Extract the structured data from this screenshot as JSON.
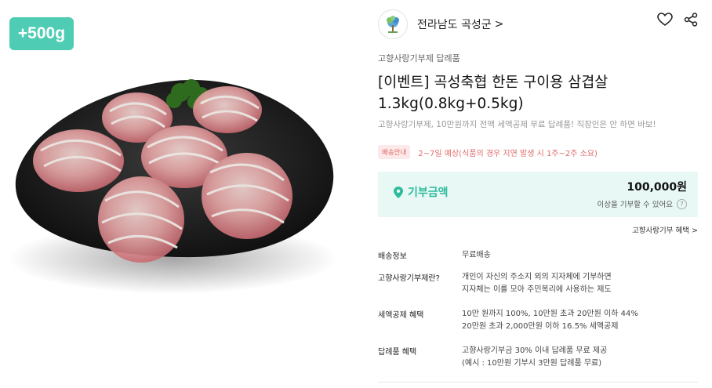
{
  "badge": "+500g",
  "seller": {
    "name": "전라남도 곡성군",
    "chevron": ">"
  },
  "icons": {
    "logo": "tree-logo-icon",
    "like": "heart-icon",
    "share": "share-icon"
  },
  "category": "고향사랑기부제 답례품",
  "title_line1": "[이벤트] 곡성축협 한돈 구이용 삼겹살",
  "title_line2": "1.3kg(0.8kg+0.5kg)",
  "description": "고향사랑기부제, 10만원까지 전액 세액공제 무료 답례품! 직장인은 안 하면 바보!",
  "shipping": {
    "tag": "배송안내",
    "text": "2~7일 예상(식품의 경우 지연 발생 시 1주~2주 소요)"
  },
  "donation": {
    "label": "기부금액",
    "amount": "100,000원",
    "sub": "이상을 기부할 수 있어요",
    "help": "?"
  },
  "benefit_link": "고향사랑기부 혜택 >",
  "info_rows": [
    {
      "label": "배송정보",
      "lines": [
        "무료배송"
      ]
    },
    {
      "label": "고향사랑기부제란?",
      "lines": [
        "개인이 자신의 주소지 외의 지자체에 기부하면",
        "지자체는 이를 모아 주민복리에 사용하는 제도"
      ]
    },
    {
      "label": "세액공제 혜택",
      "lines": [
        "10만 원까지 100%, 10만원 초과 20만원 이하 44%",
        "20만원 초과 2,000만원 이하 16.5% 세액공제"
      ]
    },
    {
      "label": "답례품 혜택",
      "lines": [
        "고향사랑기부금 30% 이내 답례품 무료 제공",
        "(예시 : 10만원 기부시 3만원 답례품 무료)"
      ]
    }
  ],
  "colors": {
    "accent": "#2dbb9c",
    "badge": "#4ecdb4",
    "shipping": "#e06a6a"
  }
}
